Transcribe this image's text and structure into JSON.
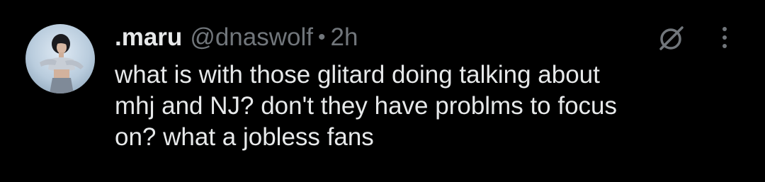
{
  "colors": {
    "background": "#000000",
    "primary_text": "#e7e9ea",
    "secondary_text": "#71767b"
  },
  "tweet": {
    "avatar_icon": "user-avatar-photo",
    "display_name": ".maru",
    "handle": "@dnaswolf",
    "separator": "•",
    "timestamp": "2h",
    "grok_icon": "grok-slash-circle-icon",
    "more_icon": "more-vertical-icon",
    "text": "what is with those glitard doing talking about\nmhj and NJ? don't they have problms to focus\non? what a jobless fans"
  }
}
